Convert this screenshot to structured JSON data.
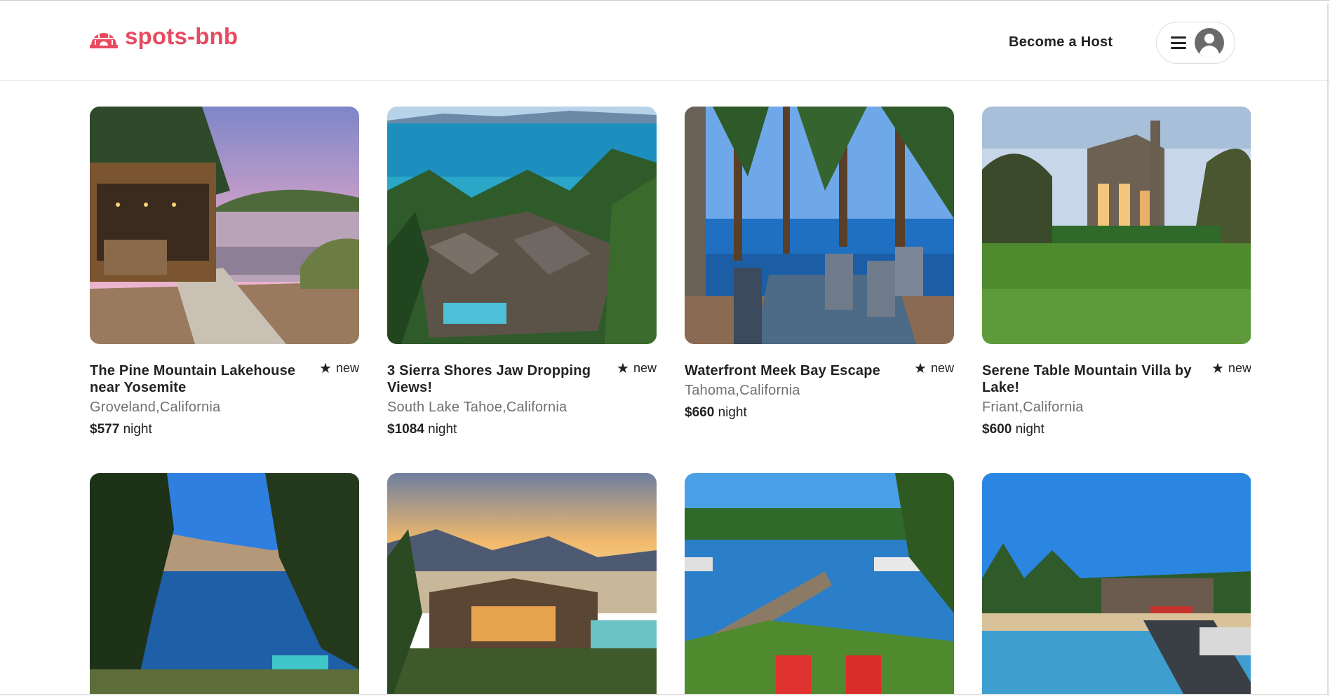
{
  "brand": {
    "name": "spots-bnb",
    "accent": "#e84a5f"
  },
  "header": {
    "become_host": "Become a Host"
  },
  "listings": [
    {
      "title": "The Pine Mountain Lakehouse near Yosemite",
      "rating": "new",
      "location": "Groveland,California",
      "price": "$577",
      "unit": "night"
    },
    {
      "title": "3 Sierra Shores Jaw Dropping Views!",
      "rating": "new",
      "location": "South Lake Tahoe,California",
      "price": "$1084",
      "unit": "night"
    },
    {
      "title": "Waterfront Meek Bay Escape",
      "rating": "new",
      "location": "Tahoma,California",
      "price": "$660",
      "unit": "night"
    },
    {
      "title": "Serene Table Mountain Villa by Lake!",
      "rating": "new",
      "location": "Friant,California",
      "price": "$600",
      "unit": "night"
    },
    {
      "title": "",
      "rating": "",
      "location": "",
      "price": "",
      "unit": ""
    },
    {
      "title": "",
      "rating": "",
      "location": "",
      "price": "",
      "unit": ""
    },
    {
      "title": "",
      "rating": "",
      "location": "",
      "price": "",
      "unit": ""
    },
    {
      "title": "",
      "rating": "",
      "location": "",
      "price": "",
      "unit": ""
    }
  ]
}
